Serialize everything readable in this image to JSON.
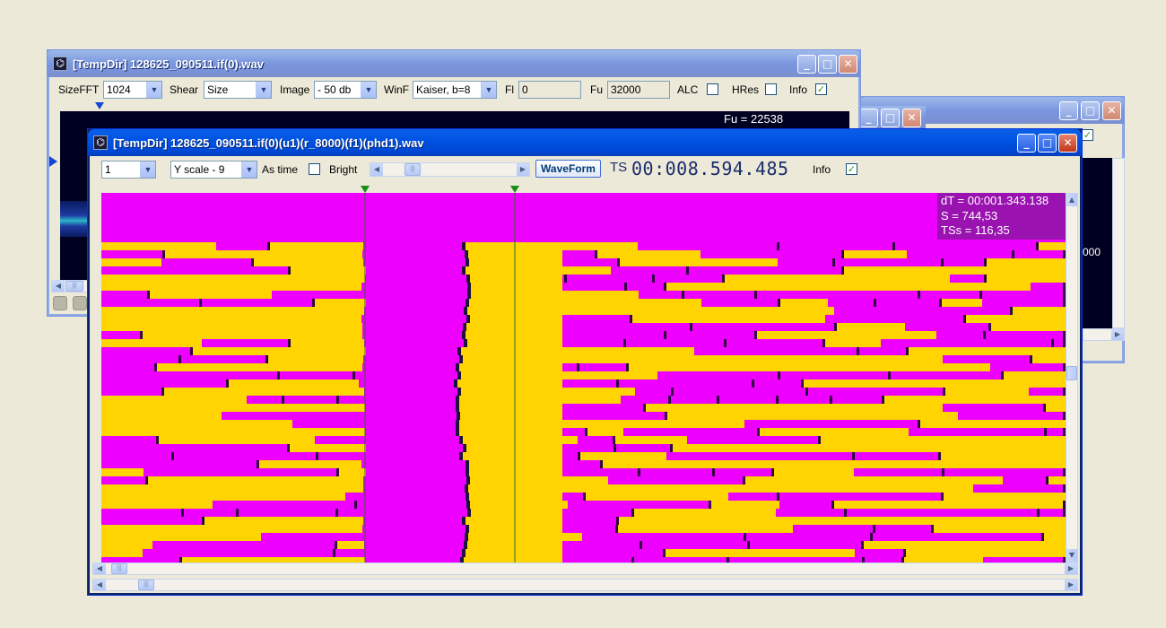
{
  "back_window": {
    "title": "[TempDir] 128625_090511.if(0).wav",
    "toolbar": {
      "sizefft_label": "SizeFFT",
      "sizefft_value": "1024",
      "shear_label": "Shear",
      "shear_value": "Size",
      "image_label": "Image",
      "image_value": "- 50 db",
      "winf_label": "WinF",
      "winf_value": "Kaiser, b=8",
      "fl_label": "Fl",
      "fl_value": "0",
      "fu_label": "Fu",
      "fu_value": "32000",
      "alc_label": "ALC",
      "hres_label": "HRes",
      "info_label": "Info",
      "alc_checked": false,
      "hres_checked": false,
      "info_checked": true
    },
    "fu_readout": "Fu = 22538"
  },
  "right_window": {
    "partial_readout": "000"
  },
  "front_window": {
    "title": "[TempDir] 128625_090511.if(0)(u1)(r_8000)(f1)(phd1).wav",
    "toolbar": {
      "channel_value": "1",
      "yscale_value": "Y scale - 9",
      "astime_label": "As time",
      "bright_label": "Bright",
      "waveform_button": "WaveForm",
      "ts_label": "TS",
      "ts_value": "00:008.594.485",
      "info_label": "Info",
      "astime_checked": false,
      "bright_checked": false,
      "info_checked": true
    },
    "info_overlay": {
      "line1": "dT = 00:001.343.138",
      "line2": "S = 744,53",
      "line3": "TSs = 116,35"
    }
  },
  "colors": {
    "magenta": "#ee00ff",
    "yellow": "#ffd400",
    "marker_green": "#1a8c1a",
    "info_box": "#9a13b0",
    "spectrum_bg": "#000020"
  },
  "icons": [
    "app-icon",
    "minimize-icon",
    "maximize-icon",
    "close-icon",
    "chevron-down-icon",
    "chevron-left-icon",
    "chevron-right-icon",
    "chevron-up-icon",
    "checkmark-icon",
    "triangle-marker-icon"
  ]
}
